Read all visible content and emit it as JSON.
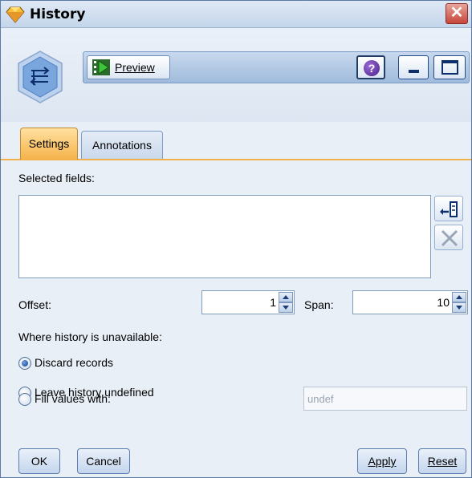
{
  "window": {
    "title": "History",
    "close_glyph": "✕"
  },
  "toolbar": {
    "preview_label": "Preview",
    "help_glyph": "?"
  },
  "tabs": [
    {
      "label": "Settings",
      "active": true
    },
    {
      "label": "Annotations",
      "active": false
    }
  ],
  "settings": {
    "selected_fields_label": "Selected fields:",
    "selected_fields": [],
    "offset_label": "Offset:",
    "offset_value": "1",
    "span_label": "Span:",
    "span_value": "10",
    "unavailable_label": "Where history is unavailable:",
    "options": [
      {
        "label": "Discard records",
        "selected": true
      },
      {
        "label": "Leave history undefined",
        "selected": false
      },
      {
        "label": "Fill values with:",
        "selected": false
      }
    ],
    "fill_value": "undef"
  },
  "buttons": {
    "ok": "OK",
    "cancel": "Cancel",
    "apply": "Apply",
    "reset": "Reset"
  },
  "colors": {
    "active_tab": "#f5b24a",
    "window_bg": "#e9eff7",
    "close_button": "#c7453a"
  },
  "icons": {
    "app": "diamond-app-icon",
    "node": "history-node-icon",
    "field_picker": "field-picker-icon",
    "remove": "delete-x-icon"
  }
}
